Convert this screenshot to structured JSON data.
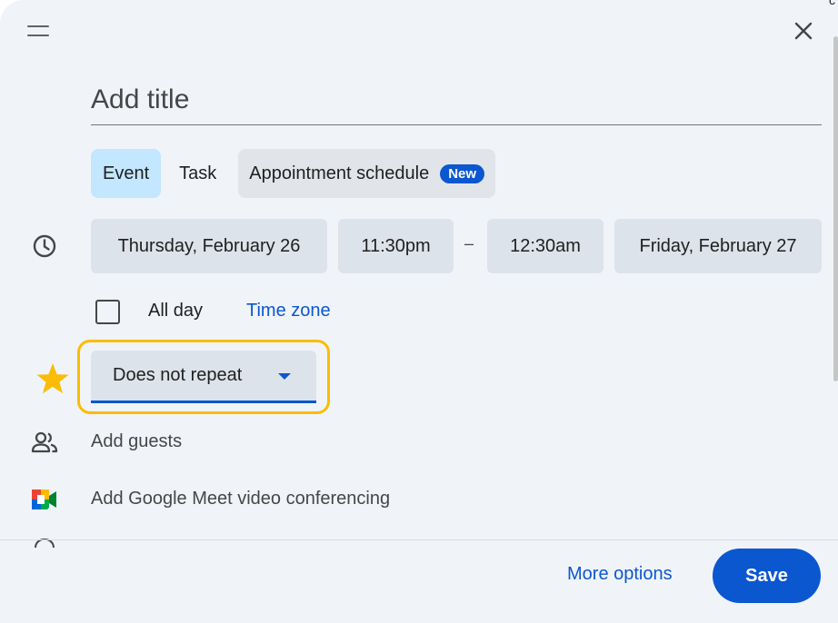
{
  "corner_text": "c",
  "title_input": {
    "placeholder": "Add title",
    "value": ""
  },
  "tabs": [
    {
      "label": "Event",
      "active": true
    },
    {
      "label": "Task",
      "active": false
    },
    {
      "label": "Appointment schedule",
      "active": false,
      "badge": "New"
    }
  ],
  "datetime": {
    "start_date": "Thursday, February 26",
    "start_time": "11:30pm",
    "separator": "–",
    "end_time": "12:30am",
    "end_date": "Friday, February 27"
  },
  "all_day": {
    "label": "All day",
    "checked": false
  },
  "time_zone_link": "Time zone",
  "repeat": {
    "selected": "Does not repeat"
  },
  "guests": {
    "label": "Add guests"
  },
  "meet": {
    "label": "Add Google Meet video conferencing"
  },
  "footer": {
    "more_options": "More options",
    "save": "Save"
  },
  "icons": {
    "drag": "drag-handle-icon",
    "close": "close-icon",
    "clock": "clock-icon",
    "star": "star-icon",
    "guests": "people-icon",
    "meet": "google-meet-icon"
  },
  "colors": {
    "accent": "#0b57d0",
    "active_tab": "#c2e7ff",
    "highlight": "#fbbc04",
    "star": "#fbbc04",
    "surface": "#f0f4f9"
  }
}
